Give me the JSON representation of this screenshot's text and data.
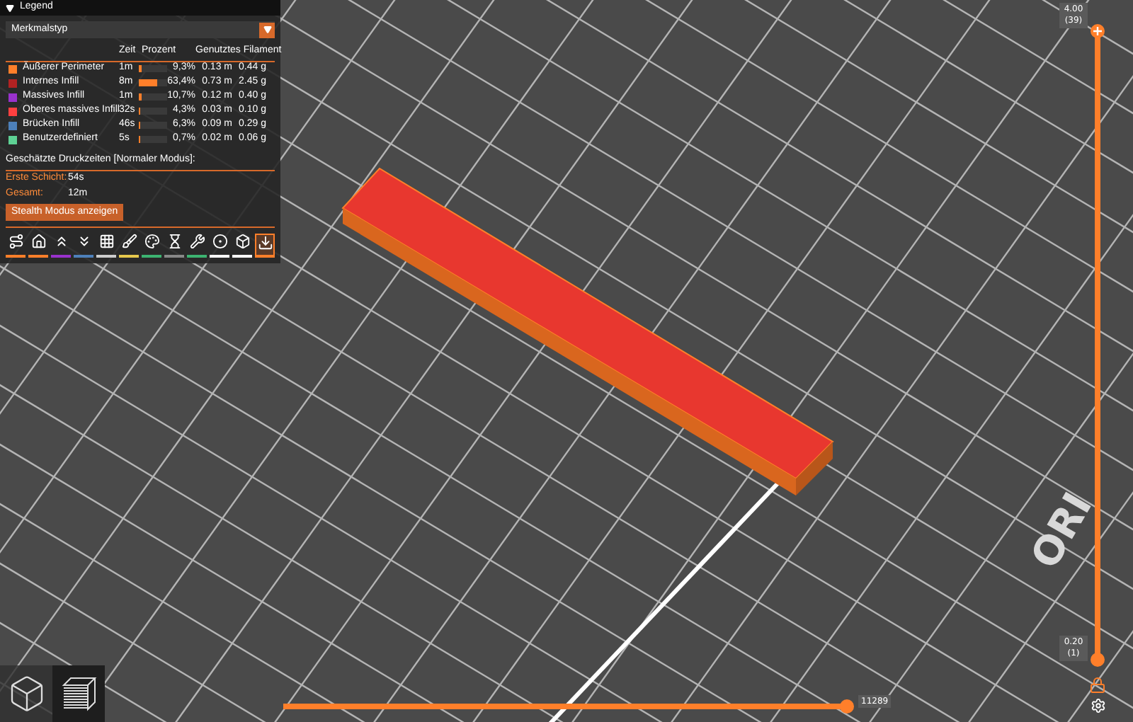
{
  "legend": {
    "title": "Legend",
    "view_type": "Merkmalstyp",
    "columns": [
      "Zeit",
      "Prozent",
      "Genutztes Filament"
    ],
    "rows": [
      {
        "name": "Äußerer Perimeter",
        "color": "#ff7f2a",
        "time": "1m",
        "percent": "9,3%",
        "level": 0.093,
        "length": "0.13 m",
        "weight": "0.44 g"
      },
      {
        "name": "Internes Infill",
        "color": "#b22222",
        "time": "8m",
        "percent": "63,4%",
        "level": 0.634,
        "length": "0.73 m",
        "weight": "2.45 g"
      },
      {
        "name": "Massives Infill",
        "color": "#9932cc",
        "time": "1m",
        "percent": "10,7%",
        "level": 0.107,
        "length": "0.12 m",
        "weight": "0.40 g"
      },
      {
        "name": "Oberes massives Infill",
        "color": "#ff4040",
        "time": "32s",
        "percent": "4,3%",
        "level": 0.043,
        "length": "0.03 m",
        "weight": "0.10 g"
      },
      {
        "name": "Brücken Infill",
        "color": "#4d80ba",
        "time": "46s",
        "percent": "6,3%",
        "level": 0.063,
        "length": "0.09 m",
        "weight": "0.29 g"
      },
      {
        "name": "Benutzerdefiniert",
        "color": "#5ed194",
        "time": "5s",
        "percent": "0,7%",
        "level": 0.007,
        "length": "0.02 m",
        "weight": "0.06 g"
      }
    ],
    "times_title": "Geschätzte Druckzeiten [Normaler Modus]:",
    "times": [
      {
        "label": "Erste Schicht:",
        "value": "54s"
      },
      {
        "label": "Gesamt:",
        "value": "12m"
      }
    ],
    "stealth_button": "Stealth Modus anzeigen"
  },
  "toolbar": [
    {
      "color": "#ff7f2a",
      "selected": false
    },
    {
      "color": "#ff7f2a",
      "selected": false
    },
    {
      "color": "#9932cc",
      "selected": false
    },
    {
      "color": "#4d80ba",
      "selected": false
    },
    {
      "color": "#cccccc",
      "selected": false
    },
    {
      "color": "#e6c84c",
      "selected": false
    },
    {
      "color": "#3cb371",
      "selected": false
    },
    {
      "color": "#888888",
      "selected": false
    },
    {
      "color": "#3cb371",
      "selected": false
    },
    {
      "color": "#ffffff",
      "selected": false
    },
    {
      "color": "#ffffff",
      "selected": false
    },
    {
      "color": "#ff7f2a",
      "selected": true
    }
  ],
  "bed_logo": "ORI",
  "layer_slider": {
    "upper": {
      "label": "4.00",
      "sub": "(39)",
      "level": 1
    },
    "lower": {
      "label": "0.20",
      "sub": "(1)",
      "level": 0
    }
  },
  "move_slider": {
    "label": "11289",
    "level": 1
  },
  "view_buttons": [
    {
      "kind": "cube",
      "selected": false
    },
    {
      "kind": "layers",
      "selected": true
    }
  ]
}
